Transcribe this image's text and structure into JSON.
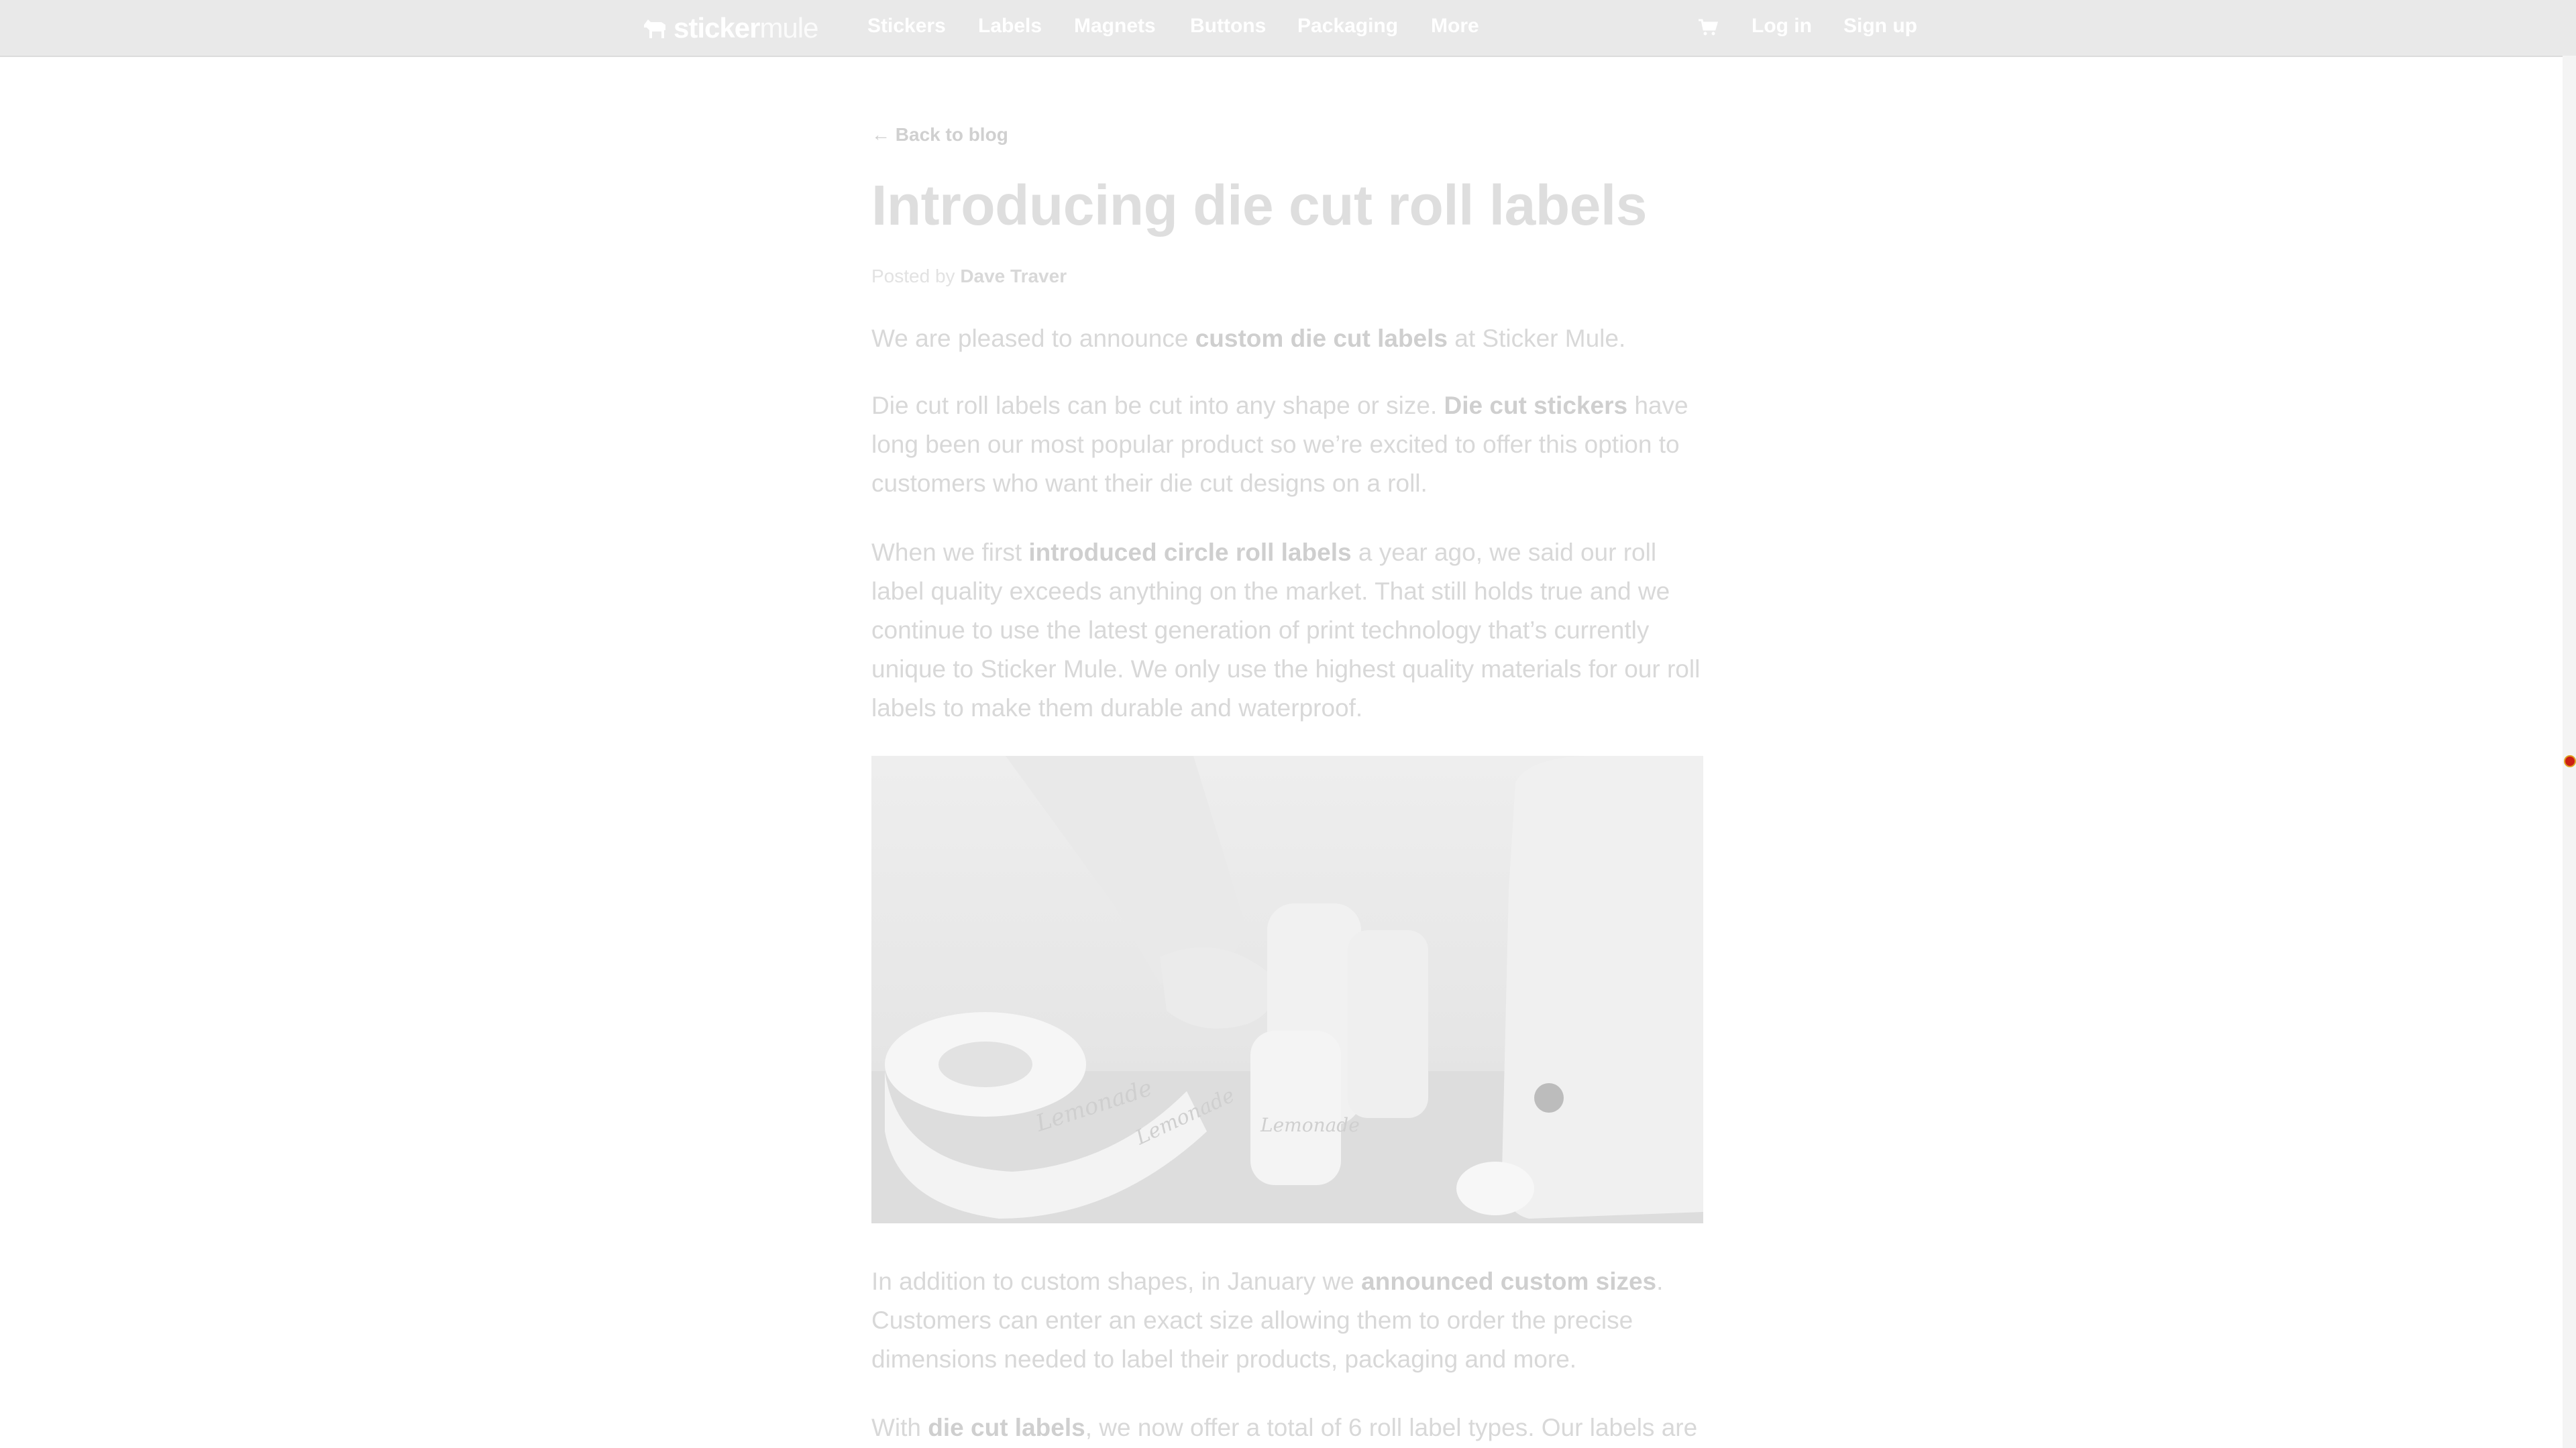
{
  "nav": {
    "logo_sticker": "sticker",
    "logo_mule": "mule",
    "items": [
      {
        "label": "Stickers"
      },
      {
        "label": "Labels"
      },
      {
        "label": "Magnets"
      },
      {
        "label": "Buttons"
      },
      {
        "label": "Packaging"
      },
      {
        "label": "More"
      }
    ],
    "cart_icon": "cart-icon",
    "login": "Log in",
    "signup": "Sign up"
  },
  "article": {
    "back": "← Back to blog",
    "title": "Introducing die cut roll labels",
    "byline_prefix": "Posted by ",
    "author": "Dave Traver",
    "p1": {
      "a": "We are pleased to announce ",
      "b": "custom die cut labels",
      "c": " at Sticker Mule."
    },
    "p2": {
      "a": "Die cut roll labels can be cut into any shape or size. ",
      "b": "Die cut stickers",
      "c": " have long been our most popular product so we’re excited to offer this option to customers who want their die cut designs on a roll."
    },
    "p3": {
      "a": "When we first ",
      "b": "introduced circle roll labels",
      "c": " a year ago, we said our roll label quality exceeds anything on the market. That still holds true and we continue to use the latest generation of print technology that’s currently unique to Sticker Mule. We only use the highest quality materials for our roll labels to make them durable and waterproof."
    },
    "image_label": "Lemonade",
    "p4": {
      "a": "In addition to custom shapes, in January we ",
      "b": "announced custom sizes",
      "c": ". Customers can enter an exact size allowing them to order the precise dimensions needed to label their products, packaging and more."
    },
    "p5": {
      "a": "With ",
      "b": "die cut labels",
      "c": ", we now offer a total of 6 roll label types. Our labels are"
    }
  }
}
